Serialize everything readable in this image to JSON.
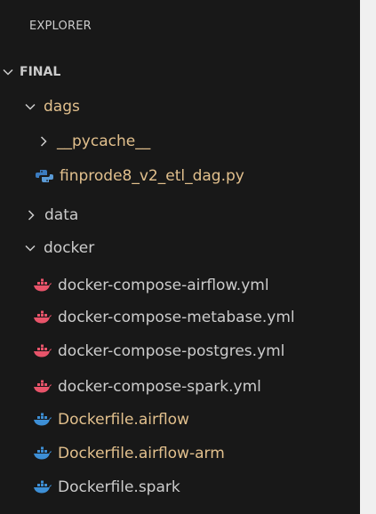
{
  "explorer": {
    "title": "EXPLORER",
    "section": "FINAL",
    "items": [
      {
        "label": "dags",
        "type": "folder",
        "expanded": true
      },
      {
        "label": "__pycache__",
        "type": "folder",
        "expanded": false
      },
      {
        "label": "finprode8_v2_etl_dag.py",
        "type": "file",
        "icon": "python-icon"
      },
      {
        "label": "data",
        "type": "folder",
        "expanded": false
      },
      {
        "label": "docker",
        "type": "folder",
        "expanded": true
      },
      {
        "label": "docker-compose-airflow.yml",
        "type": "file",
        "icon": "docker-compose-icon"
      },
      {
        "label": "docker-compose-metabase.yml",
        "type": "file",
        "icon": "docker-compose-icon"
      },
      {
        "label": "docker-compose-postgres.yml",
        "type": "file",
        "icon": "docker-compose-icon"
      },
      {
        "label": "docker-compose-spark.yml",
        "type": "file",
        "icon": "docker-compose-icon"
      },
      {
        "label": "Dockerfile.airflow",
        "type": "file",
        "icon": "dockerfile-icon"
      },
      {
        "label": "Dockerfile.airflow-arm",
        "type": "file",
        "icon": "dockerfile-icon"
      },
      {
        "label": "Dockerfile.spark",
        "type": "file",
        "icon": "dockerfile-icon"
      }
    ]
  },
  "colors": {
    "background": "#181818",
    "text": "#cccccc",
    "modified_yellow": "#e2c08d",
    "python_blue": "#3b7bbf",
    "compose_red": "#e8546a",
    "dockerfile_blue": "#3d8fd6"
  }
}
